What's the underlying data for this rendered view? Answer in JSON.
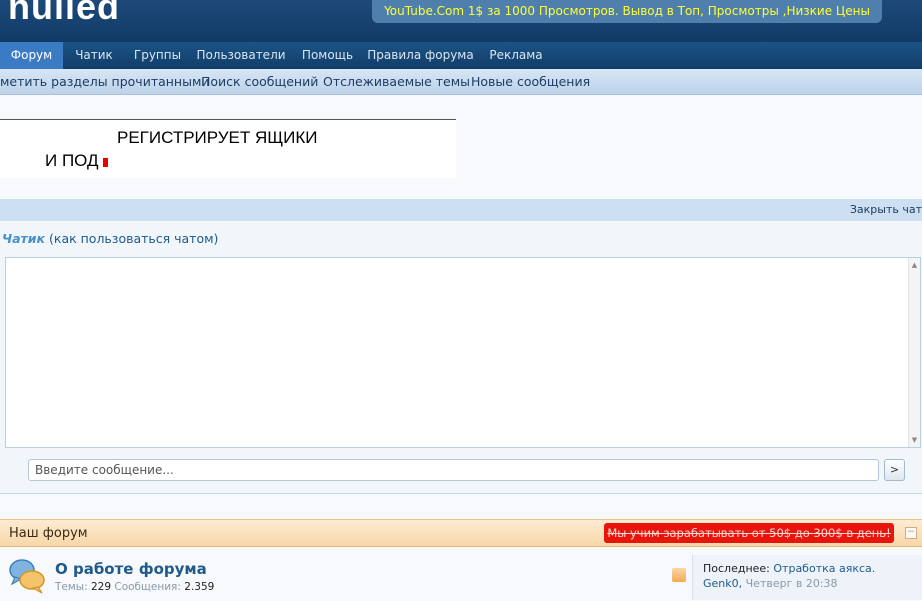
{
  "header": {
    "logo": "nulled",
    "promo": "YouTube.Com   1$ за 1000 Просмотров. Вывод в Топ, Просмотры ,Низкие Цены"
  },
  "nav": {
    "tabs": [
      {
        "label": "Форум",
        "active": true
      },
      {
        "label": "Чатик"
      },
      {
        "label": "Группы"
      },
      {
        "label": "Пользователи"
      },
      {
        "label": "Помощь"
      },
      {
        "label": "Правила форума"
      },
      {
        "label": "Реклама"
      }
    ]
  },
  "subnav": {
    "links": [
      "метить разделы прочитанными",
      "Поиск сообщений",
      "Отслеживаемые темы",
      "Новые сообщения"
    ]
  },
  "banner": {
    "line1": "РЕГИСТРИРУЕТ ЯЩИКИ",
    "line2": "И ПОД"
  },
  "chat": {
    "close_label": "Закрыть чат",
    "title": "Чатик",
    "help": "(как пользоваться чатом)",
    "input_placeholder": "Введите сообщение...",
    "send_label": ">"
  },
  "forum": {
    "section_title": "Наш форум",
    "badge": "Мы учим зарабатывать от 50$ до 300$ в день!",
    "collapse_label": "−",
    "rows": [
      {
        "title": "О работе форума",
        "topics_label": "Темы:",
        "topics": "229",
        "posts_label": "Сообщения:",
        "posts": "2.359",
        "last_label": "Последнее:",
        "last_thread": "Отработка аякса.",
        "last_user": "Genk0,",
        "last_time": "Четверг в 20:38"
      }
    ]
  },
  "colors": {
    "header_bg": "#123a66",
    "active_tab": "#3a7bc3",
    "link": "#1e5a8c",
    "badge_bg": "#e8150c",
    "promo_text": "#ffff33"
  }
}
